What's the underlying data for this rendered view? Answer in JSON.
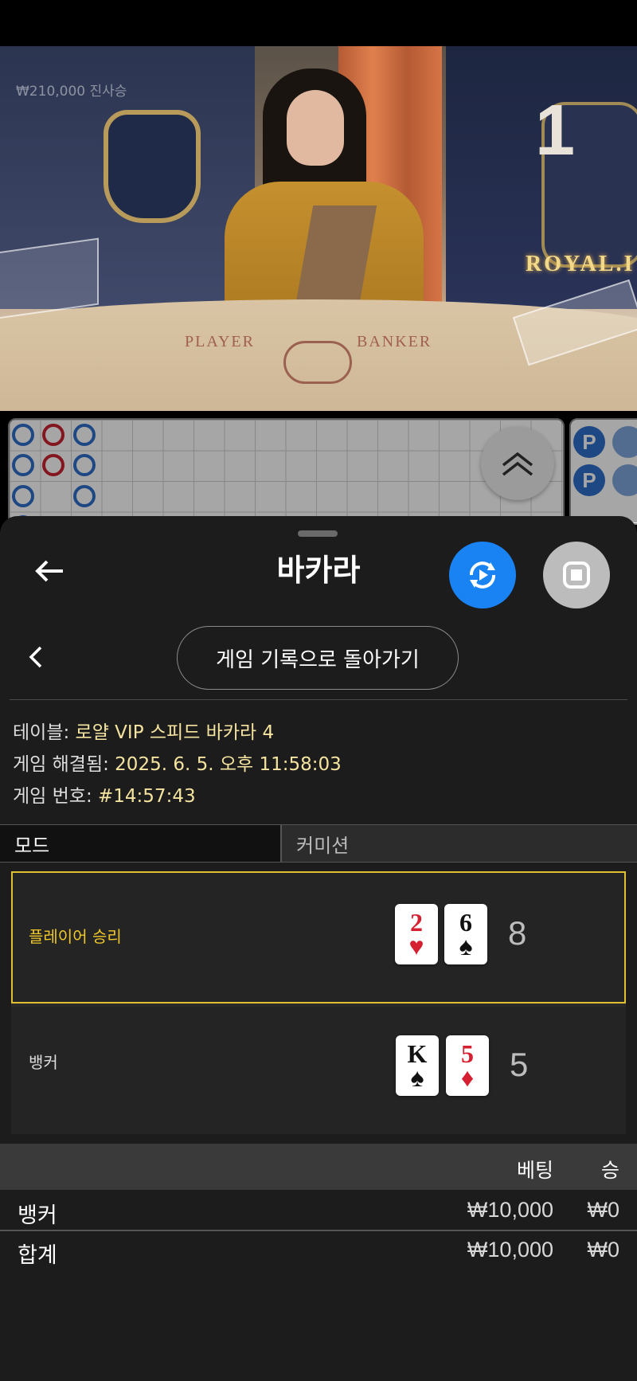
{
  "video": {
    "balance": "₩210,000 진사승",
    "round_number": "1",
    "table_words": [
      "PLAYER",
      "BANKER"
    ],
    "sign_text": "ROYAL.I"
  },
  "roadmap": {
    "columns": [
      [
        "B",
        "B",
        "B"
      ],
      [
        "R",
        "R"
      ],
      [
        "B",
        "B",
        "B"
      ]
    ],
    "bead_right": [
      "P",
      "P"
    ]
  },
  "header": {
    "title": "바카라",
    "back_icon": "arrow-left-icon",
    "history_icon": "replay-icon",
    "stop_icon": "stop-icon"
  },
  "nav": {
    "back_to_history": "게임 기록으로 돌아가기"
  },
  "info": {
    "table_label": "테이블: ",
    "table_value": "로얄 VIP 스피드 바카라 4",
    "resolved_label": "게임 해결됨: ",
    "resolved_value": "2025. 6. 5. 오후 11:58:03",
    "game_no_label": "게임 번호: ",
    "game_no_value": "#14:57:43"
  },
  "tabs": {
    "mode": "모드",
    "commission": "커미션"
  },
  "result": {
    "player": {
      "label": "플레이어 승리",
      "cards": [
        {
          "rank": "2",
          "suit": "♥"
        },
        {
          "rank": "6",
          "suit": "♠"
        }
      ],
      "score": "8"
    },
    "banker": {
      "label": "뱅커",
      "cards": [
        {
          "rank": "K",
          "suit": "♠"
        },
        {
          "rank": "5",
          "suit": "♦"
        }
      ],
      "score": "5"
    }
  },
  "bets": {
    "col_bet": "베팅",
    "col_win": "승",
    "rows": [
      {
        "name": "뱅커",
        "bet": "₩10,000",
        "win": "₩0"
      },
      {
        "name": "합계",
        "bet": "₩10,000",
        "win": "₩0"
      }
    ]
  },
  "colors": {
    "accent_blue": "#1a83f4",
    "winner_border": "#e0c030",
    "info_value": "#f5e3a0"
  }
}
